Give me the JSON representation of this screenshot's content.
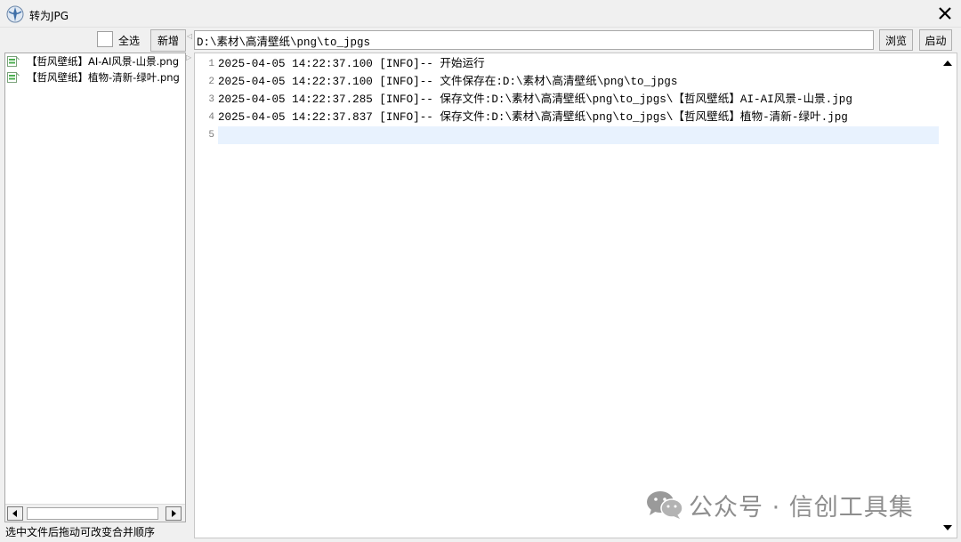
{
  "window": {
    "title": "转为JPG",
    "app_icon": "app-emblem-icon",
    "close_icon": "close-icon"
  },
  "left_panel": {
    "select_all_label": "全选",
    "select_all_checked": false,
    "add_button": "新增",
    "files": [
      {
        "name": "【哲风壁纸】AI-AI风景-山景.png",
        "icon": "image-file-icon"
      },
      {
        "name": "【哲风壁纸】植物-清新-绿叶.png",
        "icon": "image-file-icon"
      }
    ],
    "status_hint": "选中文件后拖动可改变合并顺序"
  },
  "toolbar": {
    "output_path": "D:\\素材\\高清壁纸\\png\\to_jpgs",
    "browse_button": "浏览",
    "start_button": "启动"
  },
  "log": {
    "lines": [
      {
        "num": "1",
        "text": "2025-04-05 14:22:37.100 [INFO]-- 开始运行"
      },
      {
        "num": "2",
        "text": "2025-04-05 14:22:37.100 [INFO]-- 文件保存在:D:\\素材\\高清壁纸\\png\\to_jpgs"
      },
      {
        "num": "3",
        "text": "2025-04-05 14:22:37.285 [INFO]-- 保存文件:D:\\素材\\高清壁纸\\png\\to_jpgs\\【哲风壁纸】AI-AI风景-山景.jpg"
      },
      {
        "num": "4",
        "text": "2025-04-05 14:22:37.837 [INFO]-- 保存文件:D:\\素材\\高清壁纸\\png\\to_jpgs\\【哲风壁纸】植物-清新-绿叶.jpg"
      },
      {
        "num": "5",
        "text": ""
      }
    ],
    "current_line": 5
  },
  "watermark": {
    "text": "公众号 · 信创工具集",
    "icon": "wechat-logo-icon"
  },
  "colors": {
    "window_bg": "#f0f0f0",
    "current_line_bg": "#e8f2fe",
    "file_icon_green": "#4caf50"
  }
}
